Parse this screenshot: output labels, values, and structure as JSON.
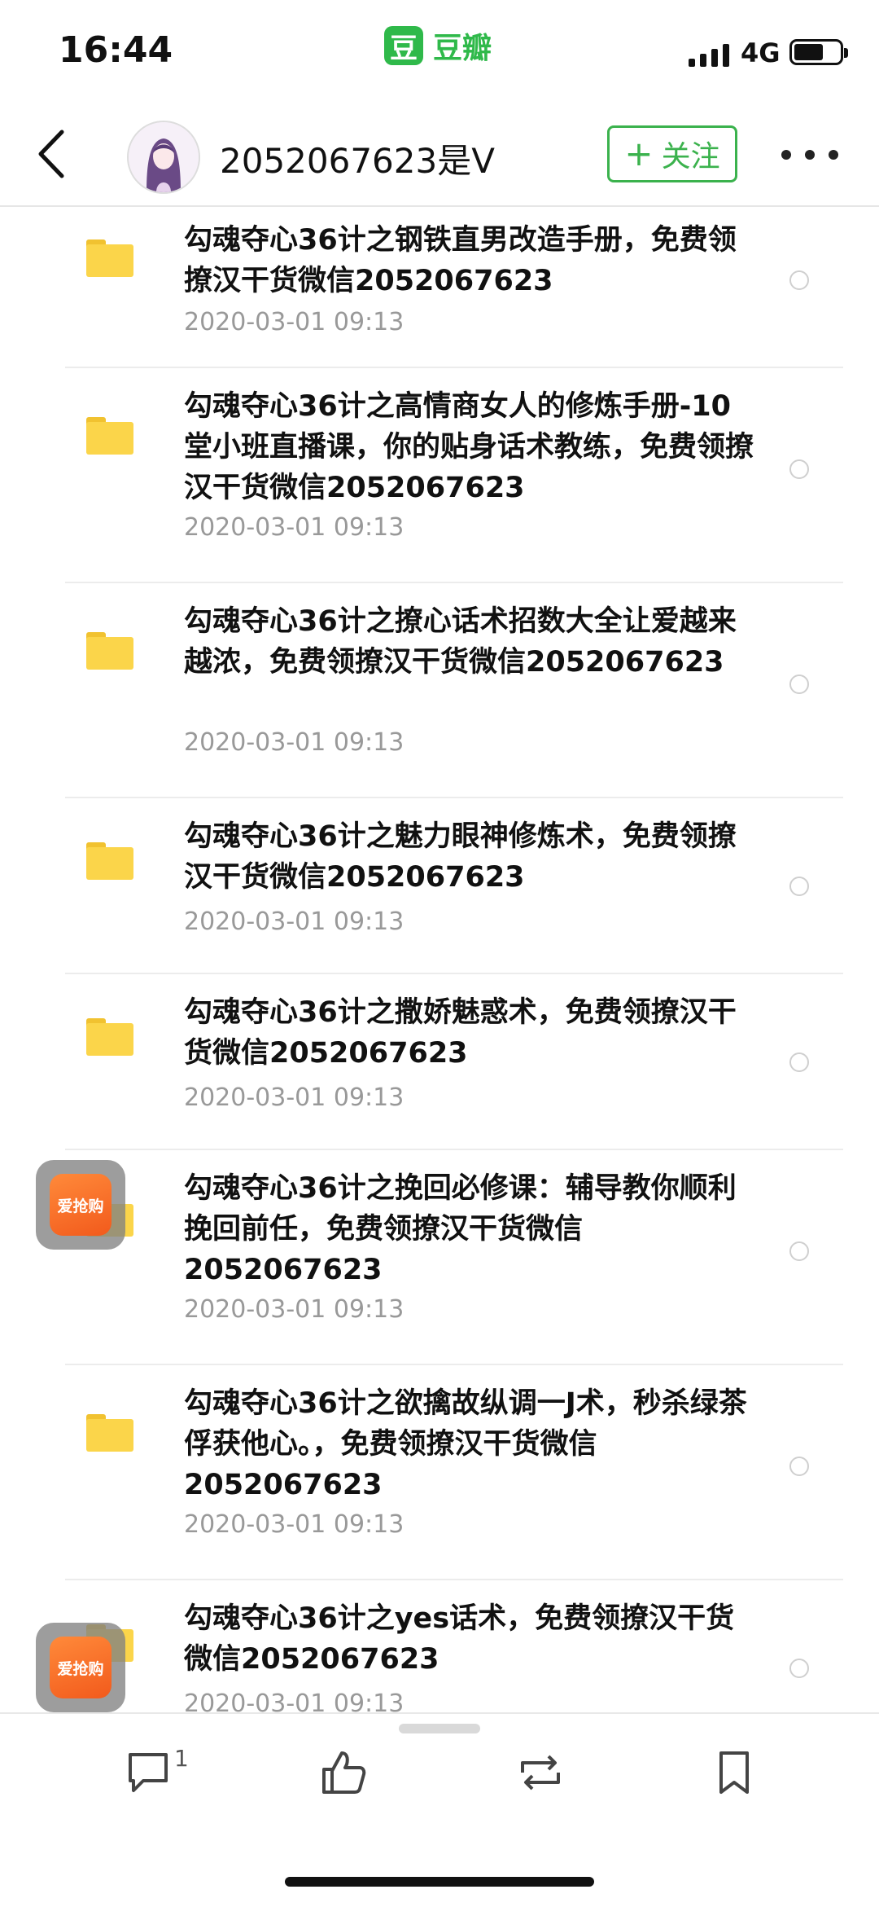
{
  "status_bar": {
    "time": "16:44",
    "app_logo_char": "豆",
    "app_name": "豆瓣",
    "network": "4G"
  },
  "header": {
    "username": "2052067623是V",
    "follow_label": "关注",
    "follow_plus": "+"
  },
  "colors": {
    "accent_green": "#3bb24d",
    "folder_yellow": "#fbd54a",
    "date_gray": "#999999"
  },
  "posts": [
    {
      "title": "勾魂夺心36计之钢铁直男改造手册，免费领撩汉干货微信2052067623",
      "date": "2020-03-01  09:13"
    },
    {
      "title": "勾魂夺心36计之高情商女人的修炼手册-10堂小班直播课，你的贴身话术教练，免费领撩汉干货微信2052067623",
      "date": "2020-03-01  09:13"
    },
    {
      "title": "勾魂夺心36计之撩心话术招数大全让爱越来越浓，免费领撩汉干货微信2052067623",
      "date": "2020-03-01  09:13"
    },
    {
      "title": "勾魂夺心36计之魅力眼神修炼术，免费领撩汉干货微信2052067623",
      "date": "2020-03-01  09:13"
    },
    {
      "title": "勾魂夺心36计之撒娇魅惑术，免费领撩汉干货微信2052067623",
      "date": "2020-03-01  09:13"
    },
    {
      "title": "勾魂夺心36计之挽回必修课：辅导教你顺利挽回前任，免费领撩汉干货微信2052067623",
      "date": "2020-03-01  09:13"
    },
    {
      "title": "勾魂夺心36计之欲擒故纵调一J术，秒杀绿茶俘获他心。，免费领撩汉干货微信2052067623",
      "date": "2020-03-01  09:13"
    },
    {
      "title": "勾魂夺心36计之yes话术，免费领撩汉干货微信2052067623",
      "date": "2020-03-01  09:13"
    }
  ],
  "floating_badge": {
    "label": "爱抢购"
  },
  "bottom_bar": {
    "comment_count": "1",
    "icons": [
      "comment-icon",
      "like-icon",
      "repost-icon",
      "bookmark-icon"
    ]
  }
}
